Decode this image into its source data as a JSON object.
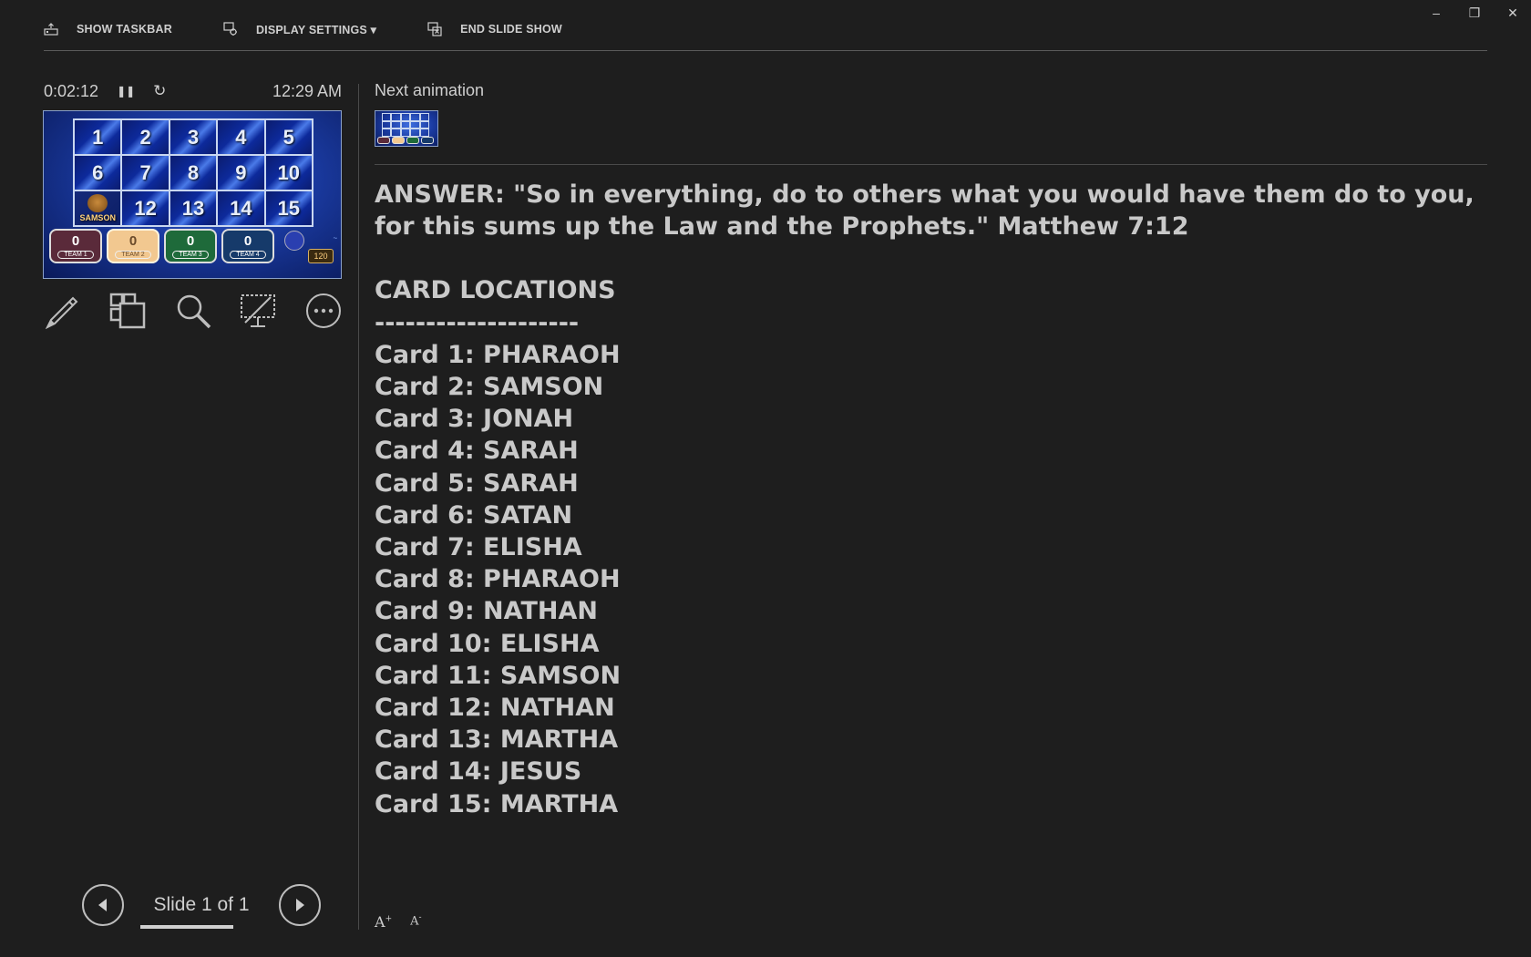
{
  "toolbar": {
    "show_taskbar": "SHOW TASKBAR",
    "display_settings": "DISPLAY SETTINGS ▾",
    "end_slide_show": "END SLIDE SHOW"
  },
  "window_controls": {
    "minimize": "–",
    "restore": "❐",
    "close": "✕"
  },
  "timer": {
    "elapsed": "0:02:12",
    "pause": "❚❚",
    "reset": "↻",
    "clock": "12:29 AM"
  },
  "current_slide": {
    "cells": [
      "1",
      "2",
      "3",
      "4",
      "5",
      "6",
      "7",
      "8",
      "9",
      "10",
      "",
      "12",
      "13",
      "14",
      "15"
    ],
    "pic_cell_label": "SAMSON",
    "teams": [
      {
        "score": "0",
        "name": "TEAM 1"
      },
      {
        "score": "0",
        "name": "TEAM 2"
      },
      {
        "score": "0",
        "name": "TEAM 3"
      },
      {
        "score": "0",
        "name": "TEAM 4"
      }
    ],
    "counter": "120"
  },
  "tools": [
    "pen-icon",
    "see-all-slides-icon",
    "zoom-icon",
    "black-screen-icon",
    "more-options-icon"
  ],
  "navigation": {
    "slide_label": "Slide 1 of 1"
  },
  "next": {
    "label": "Next animation"
  },
  "notes": {
    "answer": "ANSWER:  \"So in everything, do to others what you would have them do to you, for this sums up the Law and the Prophets.\" Matthew 7:12",
    "heading": "CARD LOCATIONS",
    "separator": "--------------------",
    "cards": [
      "Card 1:  PHARAOH",
      "Card 2:  SAMSON",
      "Card 3:  JONAH",
      "Card 4:  SARAH",
      "Card 5:  SARAH",
      "Card 6:  SATAN",
      "Card 7:  ELISHA",
      "Card 8:  PHARAOH",
      "Card 9:  NATHAN",
      "Card 10:  ELISHA",
      "Card 11:  SAMSON",
      "Card 12:  NATHAN",
      "Card 13:  MARTHA",
      "Card 14:  JESUS",
      "Card 15:  MARTHA"
    ]
  },
  "font_controls": {
    "increase": "A",
    "decrease": "A"
  }
}
